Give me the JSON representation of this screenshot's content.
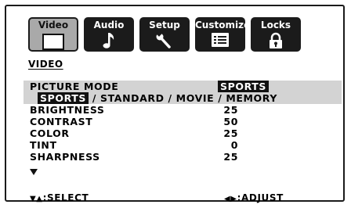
{
  "tabs": [
    {
      "label": "Video",
      "icon": "monitor-icon",
      "active": true
    },
    {
      "label": "Audio",
      "icon": "music-note-icon",
      "active": false
    },
    {
      "label": "Setup",
      "icon": "wrench-icon",
      "active": false
    },
    {
      "label": "Customize",
      "icon": "list-icon",
      "active": false
    },
    {
      "label": "Locks",
      "icon": "padlock-icon",
      "active": false
    }
  ],
  "section_title": "VIDEO",
  "picture_mode": {
    "label": "PICTURE MODE",
    "value": "SPORTS",
    "options_selected": "SPORTS",
    "options_rest": " / STANDARD / MOVIE / MEMORY"
  },
  "settings": [
    {
      "label": "BRIGHTNESS",
      "value": "25"
    },
    {
      "label": "CONTRAST",
      "value": "50"
    },
    {
      "label": "COLOR",
      "value": "25"
    },
    {
      "label": "TINT",
      "value": "0"
    },
    {
      "label": "SHARPNESS",
      "value": "25"
    }
  ],
  "footer": {
    "select_label": ":SELECT",
    "adjust_label": ":ADJUST"
  },
  "colors": {
    "active_tab": "#a9a9a9",
    "inactive_tab": "#1b1b1b",
    "highlight_row": "#d3d3d3"
  }
}
